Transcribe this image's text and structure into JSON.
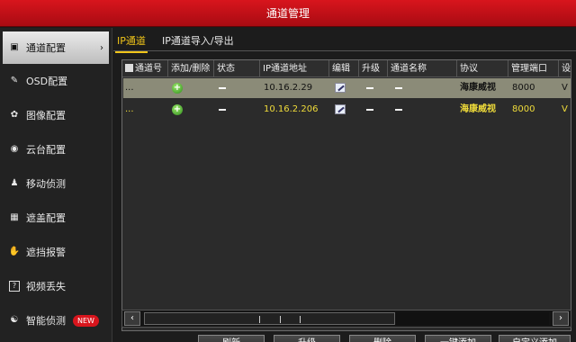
{
  "window": {
    "title": "通道管理"
  },
  "sidebar": {
    "items": [
      {
        "label": "通道配置",
        "icon": "camera-icon",
        "active": true
      },
      {
        "label": "OSD配置",
        "icon": "edit-pen-icon"
      },
      {
        "label": "图像配置",
        "icon": "image-palette-icon"
      },
      {
        "label": "云台配置",
        "icon": "ptz-icon"
      },
      {
        "label": "移动侦测",
        "icon": "running-person-icon"
      },
      {
        "label": "遮盖配置",
        "icon": "mask-icon"
      },
      {
        "label": "遮挡报警",
        "icon": "hand-icon"
      },
      {
        "label": "视频丢失",
        "icon": "question-icon"
      },
      {
        "label": "智能侦测",
        "icon": "smart-detect-icon",
        "badge": "NEW"
      }
    ]
  },
  "tabs": [
    {
      "label": "IP通道",
      "active": true
    },
    {
      "label": "IP通道导入/导出"
    }
  ],
  "table": {
    "columns": [
      "通道号",
      "添加/删除",
      "状态",
      "IP通道地址",
      "编辑",
      "升级",
      "通道名称",
      "协议",
      "管理端口",
      "设"
    ],
    "rows": [
      {
        "channel": "...",
        "ip": "10.16.2.29",
        "status": "—",
        "upgrade": "—",
        "name": "—",
        "protocol": "海康威视",
        "port": "8000",
        "extra": "V",
        "selected": true
      },
      {
        "channel": "...",
        "ip": "10.16.2.206",
        "status": "—",
        "upgrade": "—",
        "name": "—",
        "protocol": "海康威视",
        "port": "8000",
        "extra": "V",
        "selected": false
      }
    ]
  },
  "scrollbar": {
    "left_arrow": "‹",
    "right_arrow": "›"
  },
  "buttons": [
    {
      "label": "刷新"
    },
    {
      "label": "升级"
    },
    {
      "label": "删除"
    },
    {
      "label": "一键添加"
    },
    {
      "label": "自定义添加"
    }
  ],
  "colors": {
    "accent": "#f0c419",
    "titlebar": "#c4121a",
    "selected_row": "#8b8b78",
    "row_text": "#f0dc3a"
  }
}
